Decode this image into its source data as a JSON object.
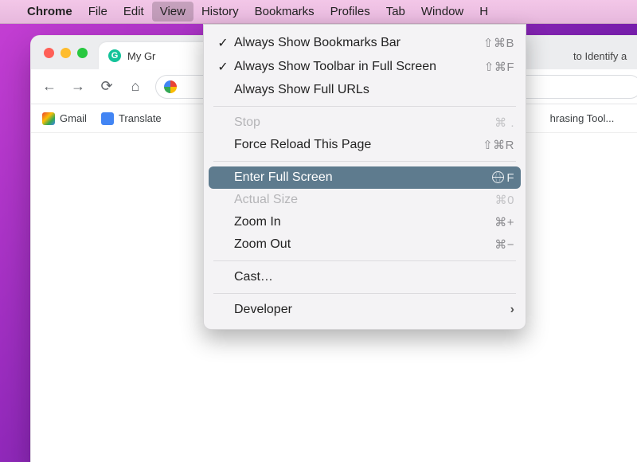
{
  "menubar": {
    "app": "Chrome",
    "items": [
      "File",
      "Edit",
      "View",
      "History",
      "Bookmarks",
      "Profiles",
      "Tab",
      "Window",
      "H"
    ],
    "active_index": 2
  },
  "chrome": {
    "tabs": [
      {
        "title": "My Gr",
        "favicon_letter": "G",
        "favicon_bg": "#15c39a"
      },
      {
        "title": "to Identify a",
        "favicon_letter": "",
        "favicon_bg": "#888"
      }
    ],
    "nav": {
      "back": "←",
      "forward": "→",
      "reload": "⟳",
      "home": "⌂"
    },
    "bookmarks": [
      {
        "label": "Gmail",
        "icon_bg": "linear-gradient(135deg,#ea4335,#fbbc05,#34a853,#4285f4)"
      },
      {
        "label": "Translate",
        "icon_bg": "#4285f4"
      },
      {
        "label": "hrasing Tool...",
        "icon_bg": "#34a853"
      }
    ]
  },
  "view_menu": {
    "groups": [
      [
        {
          "checked": true,
          "label": "Always Show Bookmarks Bar",
          "shortcut": "⇧⌘B",
          "enabled": true
        },
        {
          "checked": true,
          "label": "Always Show Toolbar in Full Screen",
          "shortcut": "⇧⌘F",
          "enabled": true
        },
        {
          "checked": false,
          "label": "Always Show Full URLs",
          "shortcut": "",
          "enabled": true
        }
      ],
      [
        {
          "checked": false,
          "label": "Stop",
          "shortcut": "⌘ .",
          "enabled": false
        },
        {
          "checked": false,
          "label": "Force Reload This Page",
          "shortcut": "⇧⌘R",
          "enabled": true
        }
      ],
      [
        {
          "checked": false,
          "label": "Enter Full Screen",
          "shortcut": "🌐F",
          "enabled": true,
          "highlight": true
        },
        {
          "checked": false,
          "label": "Actual Size",
          "shortcut": "⌘0",
          "enabled": false
        },
        {
          "checked": false,
          "label": "Zoom In",
          "shortcut": "⌘+",
          "enabled": true
        },
        {
          "checked": false,
          "label": "Zoom Out",
          "shortcut": "⌘−",
          "enabled": true
        }
      ],
      [
        {
          "checked": false,
          "label": "Cast…",
          "shortcut": "",
          "enabled": true
        }
      ],
      [
        {
          "checked": false,
          "label": "Developer",
          "shortcut": "",
          "enabled": true,
          "submenu": true
        }
      ]
    ]
  }
}
